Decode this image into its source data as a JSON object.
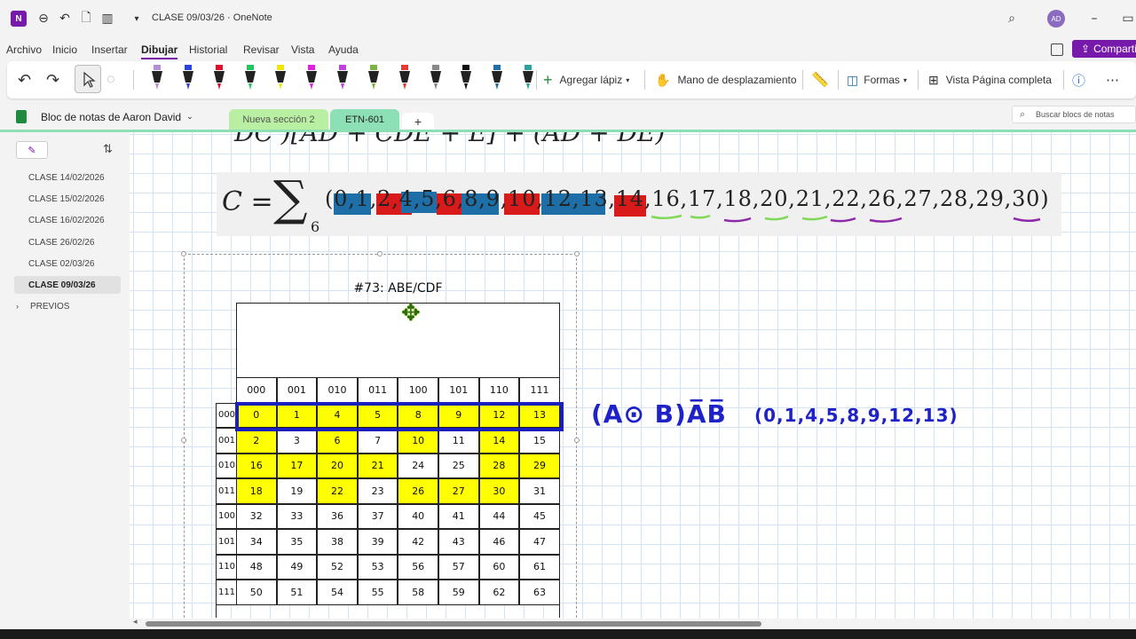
{
  "titlebar": {
    "title": "CLASE 09/03/26 · OneNote",
    "avatar_initials": "AD",
    "app_icon": "N"
  },
  "menu": {
    "items": [
      "Archivo",
      "Inicio",
      "Insertar",
      "Dibujar",
      "Historial",
      "Revisar",
      "Vista",
      "Ayuda"
    ],
    "active": "Dibujar",
    "share_label": "Compartir"
  },
  "ribbon": {
    "add_pen": "Agregar lápiz",
    "pan": "Mano de desplazamiento",
    "shapes": "Formas",
    "full_view": "Vista Página completa",
    "pen_colors": [
      "#b48fd4",
      "#2a45d8",
      "#e0102c",
      "#22c55e",
      "#f2e600",
      "#e020e0",
      "#c040e0",
      "#7cb342",
      "#e53935",
      "#888888",
      "#111111",
      "#1e6fa8",
      "#2aa39a"
    ]
  },
  "notebook": {
    "title": "Bloc de notas de Aaron David",
    "sections": [
      "Nueva sección 2",
      "ETN-601"
    ],
    "add_section": "+",
    "search_placeholder": "Buscar blocs de notas"
  },
  "pages": {
    "items": [
      "CLASE 14/02/2026",
      "CLASE 15/02/2026",
      "CLASE 16/02/2026",
      "CLASE 26/02/26",
      "CLASE 02/03/26",
      "CLASE 09/03/26"
    ],
    "active": "CLASE 09/03/26",
    "group": "PREVIOS"
  },
  "formula": {
    "lhs": "C =",
    "sum": "∑",
    "sub": "6",
    "terms": "(0,1,2,4,5,6,8,9,10,12,13,14,16,17,18,20,21,22,26,27,28,29,30)"
  },
  "formula_top_partial": "DC )[AD + CDE + E] + (AD + DE)",
  "kmap": {
    "title": "#73: ABE/CDF",
    "col_headers": [
      "000",
      "001",
      "010",
      "011",
      "100",
      "101",
      "110",
      "111"
    ],
    "row_headers": [
      "000",
      "001",
      "010",
      "011",
      "100",
      "101",
      "110",
      "111"
    ],
    "cells": [
      [
        "0",
        "1",
        "4",
        "5",
        "8",
        "9",
        "12",
        "13"
      ],
      [
        "2",
        "3",
        "6",
        "7",
        "10",
        "11",
        "14",
        "15"
      ],
      [
        "16",
        "17",
        "20",
        "21",
        "24",
        "25",
        "28",
        "29"
      ],
      [
        "18",
        "19",
        "22",
        "23",
        "26",
        "27",
        "30",
        "31"
      ],
      [
        "32",
        "33",
        "36",
        "37",
        "40",
        "41",
        "44",
        "45"
      ],
      [
        "34",
        "35",
        "38",
        "39",
        "42",
        "43",
        "46",
        "47"
      ],
      [
        "48",
        "49",
        "52",
        "53",
        "56",
        "57",
        "60",
        "61"
      ],
      [
        "50",
        "51",
        "54",
        "55",
        "58",
        "59",
        "62",
        "63"
      ]
    ],
    "highlight_color": "#ffff00",
    "highlight_rows_cols": [
      [
        0,
        0
      ],
      [
        0,
        1
      ],
      [
        0,
        2
      ],
      [
        0,
        3
      ],
      [
        0,
        4
      ],
      [
        0,
        5
      ],
      [
        0,
        6
      ],
      [
        0,
        7
      ],
      [
        1,
        0
      ],
      [
        1,
        2
      ],
      [
        1,
        4
      ],
      [
        1,
        6
      ],
      [
        2,
        0
      ],
      [
        2,
        1
      ],
      [
        2,
        2
      ],
      [
        2,
        3
      ],
      [
        2,
        6
      ],
      [
        2,
        7
      ],
      [
        3,
        0
      ],
      [
        3,
        2
      ],
      [
        3,
        4
      ],
      [
        3,
        5
      ],
      [
        3,
        6
      ]
    ]
  },
  "ink": {
    "expr": "(A⊙ B)A̅B̅",
    "terms": "(0,1,4,5,8,9,12,13)",
    "color": "#1e22c8"
  }
}
